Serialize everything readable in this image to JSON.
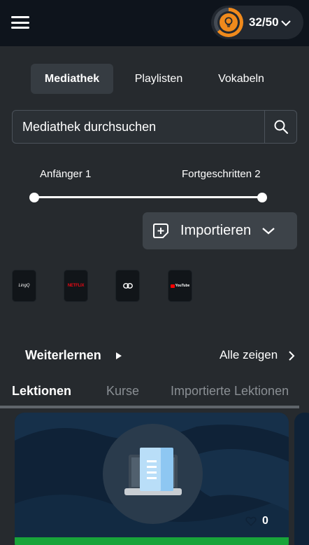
{
  "header": {
    "menu_icon": "hamburger-menu-icon",
    "streak": {
      "icon": "lightbulb-icon",
      "count": "32/50",
      "progress": 0.64,
      "accent": "#f08a1c"
    }
  },
  "tabs": [
    {
      "label": "Mediathek",
      "active": true
    },
    {
      "label": "Playlisten",
      "active": false
    },
    {
      "label": "Vokabeln",
      "active": false
    }
  ],
  "search": {
    "placeholder": "Mediathek durchsuchen",
    "value": "",
    "icon": "search-icon"
  },
  "level": {
    "min_label": "Anfänger 1",
    "max_label": "Fortgeschritten 2"
  },
  "import": {
    "label": "Importieren",
    "icon": "add-document-icon"
  },
  "sources": [
    {
      "label": "LingQ",
      "icon": "lingq-logo"
    },
    {
      "label": "NETFLIX",
      "icon": "netflix-logo"
    },
    {
      "label": "",
      "icon": "link-logo"
    },
    {
      "label": "YouTube",
      "icon": "youtube-logo"
    }
  ],
  "continue_section": {
    "title": "Weiterlernen",
    "show_all": "Alle zeigen"
  },
  "sub_tabs": [
    {
      "label": "Lektionen",
      "active": true
    },
    {
      "label": "Kurse",
      "active": false
    },
    {
      "label": "Importierte Lektionen",
      "active": false
    }
  ],
  "lesson_card": {
    "icon": "document-laptop-icon",
    "likes": "0",
    "progress_color": "#18a43a"
  },
  "colors": {
    "background": "#262a2e",
    "header": "#0e141c",
    "accent": "#f08a1c",
    "progress": "#18a43a"
  }
}
